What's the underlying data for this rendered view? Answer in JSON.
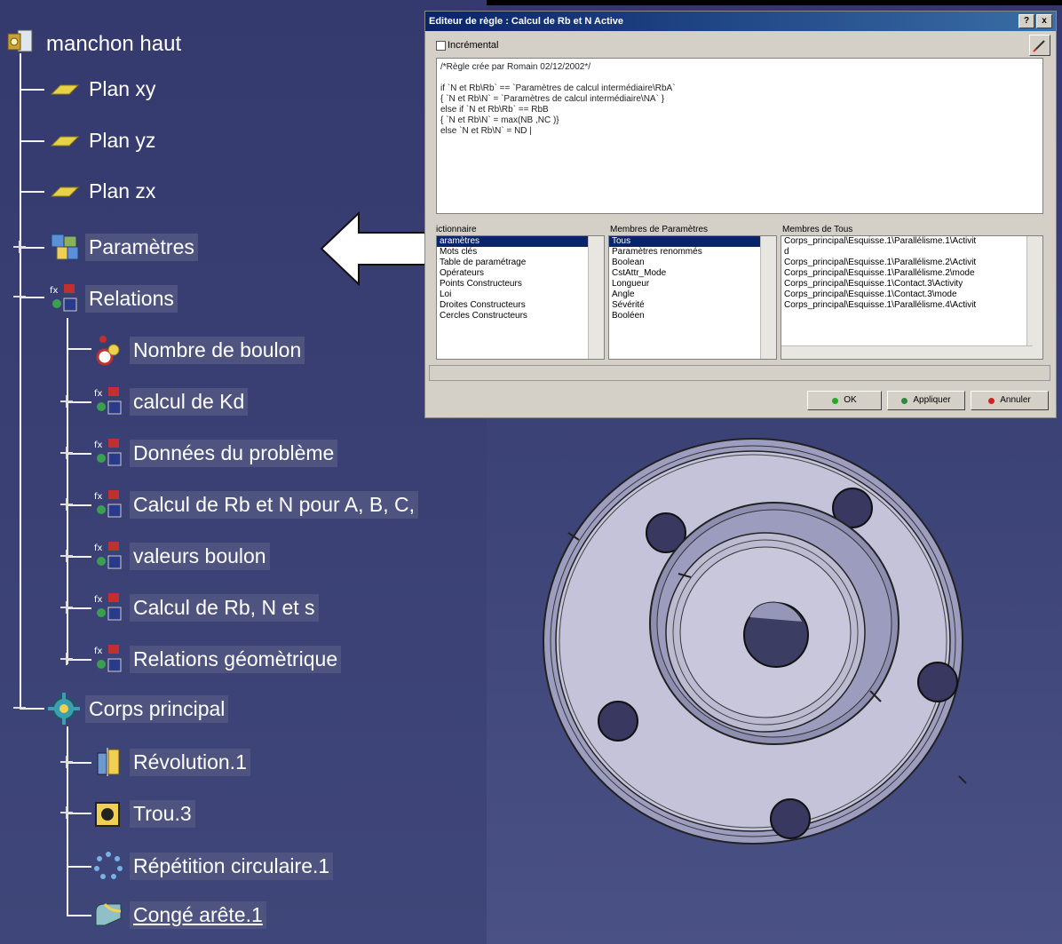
{
  "tree": {
    "root": "manchon haut",
    "items": [
      "Plan xy",
      "Plan yz",
      "Plan zx",
      "Paramètres",
      "Relations",
      "Nombre de boulon",
      "calcul de Kd",
      "Données du problème",
      "Calcul de Rb et N pour A, B, C,",
      "valeurs boulon",
      "Calcul de Rb, N et s",
      "Relations géomètrique",
      "Corps principal",
      "Révolution.1",
      "Trou.3",
      "Répétition circulaire.1",
      "Congé arête.1"
    ]
  },
  "dialog": {
    "title": "Editeur de règle : Calcul de Rb et N Active",
    "help": "?",
    "close": "x",
    "incremental": "Incrémental",
    "rule_text": "/*Règle crée par Romain 02/12/2002*/\n\nif `N et Rb\\Rb` == `Paramètres de calcul intermédiaire\\RbA`\n{ `N et Rb\\N` = `Paramètres de calcul intermédiaire\\NA` }\nelse if `N et Rb\\Rb` == RbB\n{ `N et Rb\\N` = max(NB ,NC )}\nelse `N et Rb\\N` = ND |",
    "dictionary_header": "ictionnaire",
    "dictionary_items": [
      "aramètres",
      "Mots clés",
      "Table de paramétrage",
      "Opérateurs",
      "Points Constructeurs",
      "Loi",
      "Droites Constructeurs",
      "Cercles Constructeurs"
    ],
    "params_header": "Membres de Paramètres",
    "params_items": [
      "Tous",
      "Paramètres renommés",
      "Boolean",
      "CstAttr_Mode",
      "Longueur",
      "Angle",
      "Sévérité",
      "Booléen"
    ],
    "all_header": "Membres de Tous",
    "all_items": [
      "Corps_principal\\Esquisse.1\\Parallélisme.1\\Activit",
      "d",
      "Corps_principal\\Esquisse.1\\Parallélisme.2\\Activit",
      "Corps_principal\\Esquisse.1\\Parallélisme.2\\mode",
      "Corps_principal\\Esquisse.1\\Contact.3\\Activity",
      "Corps_principal\\Esquisse.1\\Contact.3\\mode",
      "Corps_principal\\Esquisse.1\\Parallélisme.4\\Activit"
    ],
    "ok": "OK",
    "apply": "Appliquer",
    "cancel": "Annuler"
  },
  "colors": {
    "ok_dot": "#22aa22",
    "apply_dot": "#2a8a3a",
    "cancel_dot": "#cc2222",
    "accent": "#0a246a"
  }
}
